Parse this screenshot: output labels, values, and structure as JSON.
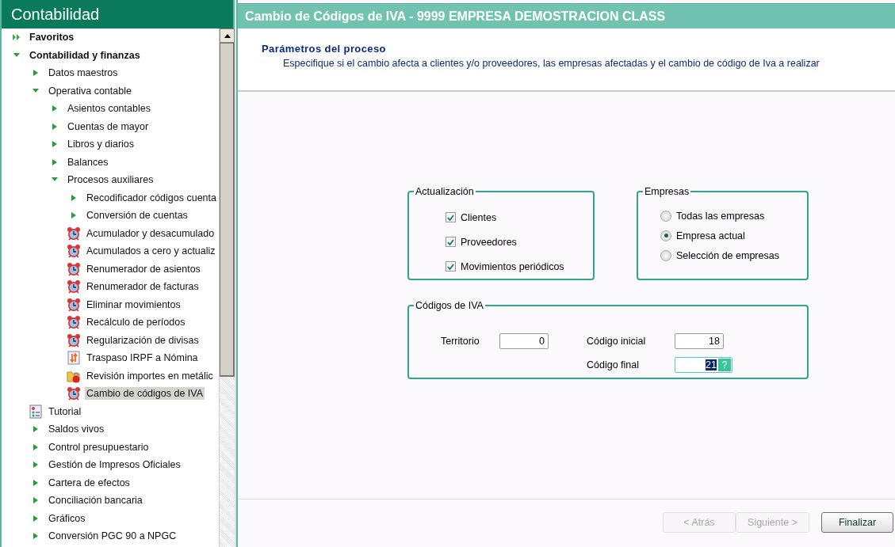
{
  "sidebar": {
    "title": "Contabilidad",
    "tree": [
      {
        "label": "Favoritos",
        "kind": "favorites",
        "selected": false
      },
      {
        "label": "Contabilidad y finanzas",
        "kind": "branch",
        "expanded": true,
        "selected": false,
        "children": [
          {
            "label": "Datos maestros",
            "kind": "branch",
            "expanded": false,
            "selected": false
          },
          {
            "label": "Operativa contable",
            "kind": "branch",
            "expanded": true,
            "selected": false,
            "children": [
              {
                "label": "Asientos contables",
                "kind": "branch",
                "expanded": false,
                "selected": false
              },
              {
                "label": "Cuentas de mayor",
                "kind": "branch",
                "expanded": false,
                "selected": false
              },
              {
                "label": "Libros y diarios",
                "kind": "branch",
                "expanded": false,
                "selected": false
              },
              {
                "label": "Balances",
                "kind": "branch",
                "expanded": false,
                "selected": false
              },
              {
                "label": "Procesos auxiliares",
                "kind": "branch",
                "expanded": true,
                "selected": false,
                "children": [
                  {
                    "label": "Recodificador códigos cuenta",
                    "kind": "branch",
                    "expanded": false,
                    "selected": false
                  },
                  {
                    "label": "Conversión de cuentas",
                    "kind": "branch",
                    "expanded": false,
                    "selected": false
                  },
                  {
                    "label": "Acumulador y desacumulado",
                    "kind": "process",
                    "selected": false
                  },
                  {
                    "label": "Acumulados a cero y actualiz",
                    "kind": "process",
                    "selected": false
                  },
                  {
                    "label": "Renumerador de asientos",
                    "kind": "process",
                    "selected": false
                  },
                  {
                    "label": "Renumerador de facturas",
                    "kind": "process",
                    "selected": false
                  },
                  {
                    "label": "Eliminar movimientos",
                    "kind": "process",
                    "selected": false
                  },
                  {
                    "label": "Recálculo de períodos",
                    "kind": "process",
                    "selected": false
                  },
                  {
                    "label": "Regularización de divisas",
                    "kind": "process",
                    "selected": false
                  },
                  {
                    "label": "Traspaso IRPF a Nómina",
                    "kind": "transfer",
                    "selected": false
                  },
                  {
                    "label": "Revisión importes en metálic",
                    "kind": "folder",
                    "selected": false
                  },
                  {
                    "label": "Cambio de códigos de IVA",
                    "kind": "process",
                    "selected": true
                  }
                ]
              }
            ]
          },
          {
            "label": "Tutorial",
            "kind": "tutorial",
            "selected": false
          },
          {
            "label": "Saldos vivos",
            "kind": "branch",
            "expanded": false,
            "selected": false
          },
          {
            "label": "Control presupuestario",
            "kind": "branch",
            "expanded": false,
            "selected": false
          },
          {
            "label": "Gestión de Impresos Oficiales",
            "kind": "branch",
            "expanded": false,
            "selected": false
          },
          {
            "label": "Cartera de efectos",
            "kind": "branch",
            "expanded": false,
            "selected": false
          },
          {
            "label": "Conciliación bancaria",
            "kind": "branch",
            "expanded": false,
            "selected": false
          },
          {
            "label": "Gráficos",
            "kind": "branch",
            "expanded": false,
            "selected": false
          },
          {
            "label": "Conversión PGC 90 a NPGC",
            "kind": "branch",
            "expanded": false,
            "selected": false
          }
        ]
      }
    ]
  },
  "window": {
    "title": "Cambio de Códigos de IVA - 9999 EMPRESA DEMOSTRACION CLASS"
  },
  "header": {
    "title": "Parámetros del proceso",
    "description": "Especifique si el cambio afecta a clientes y/o proveedores, las empresas afectadas y el cambio de código de Iva a realizar"
  },
  "actualizacion": {
    "legend": "Actualización",
    "options": [
      {
        "label": "Clientes",
        "checked": true
      },
      {
        "label": "Proveedores",
        "checked": true
      },
      {
        "label": "Movimientos periódicos",
        "checked": true
      }
    ]
  },
  "empresas": {
    "legend": "Empresas",
    "options": [
      {
        "label": "Todas las empresas",
        "selected": false
      },
      {
        "label": "Empresa actual",
        "selected": true
      },
      {
        "label": "Selección de empresas",
        "selected": false
      }
    ]
  },
  "codigos_iva": {
    "legend": "Códigos de IVA",
    "fields": [
      {
        "label": "Territorio",
        "value": "0",
        "kind": "plain",
        "highlighted": false
      },
      {
        "label": "Código inicial",
        "value": "18",
        "kind": "plain",
        "highlighted": false
      },
      {
        "label": "Código final",
        "value": "21",
        "kind": "lookup",
        "button": "?",
        "highlighted": true
      }
    ]
  },
  "buttons": [
    {
      "label": "< Atrás",
      "disabled": true
    },
    {
      "label": "Siguiente >",
      "disabled": true
    },
    {
      "label": "Finalizar",
      "disabled": false
    }
  ]
}
